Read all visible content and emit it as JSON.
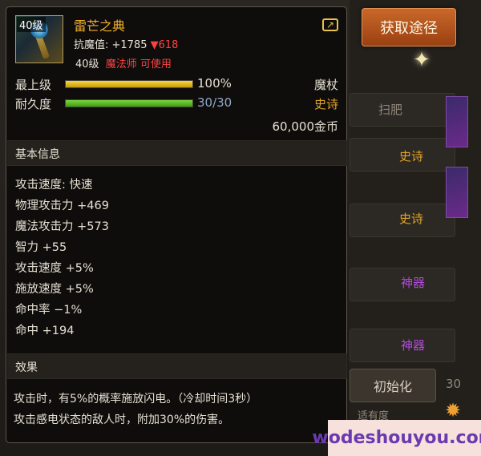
{
  "acquire_button": "获取途径",
  "item": {
    "level_badge": "40级",
    "name": "雷芒之典",
    "resist_label": "抗魔值: +1785",
    "resist_delta": "▼618",
    "req_level": "40级",
    "req_class": "魔法师 可使用"
  },
  "stats": {
    "grade_label": "最上级",
    "grade_value": "100%",
    "grade_fraction": 1.0,
    "durability_label": "耐久度",
    "durability_value": "30/30",
    "durability_fraction": 1.0,
    "type": "魔杖",
    "rarity": "史诗",
    "price": "60,000金币"
  },
  "sections": {
    "basic": "基本信息",
    "effect": "效果"
  },
  "attributes": [
    "攻击速度: 快速",
    "物理攻击力 +469",
    "魔法攻击力 +573",
    "智力 +55",
    "攻击速度 +5%",
    "施放速度 +5%",
    "命中率 −1%",
    "命中 +194"
  ],
  "effects": [
    "攻击时，有5%的概率施放闪电。（冷却时间3秒）",
    "攻击感电状态的敌人时，附加30%的伤害。"
  ],
  "background": {
    "tags": [
      "扫肥",
      "史诗",
      "史诗",
      "神器",
      "神器"
    ],
    "init_button": "初始化",
    "partial_text": "适有度",
    "partial_number": "30"
  },
  "watermark": "wodeshouyou.com",
  "colors": {
    "gold": "#f2b02a",
    "rarity_epic": "#e2a526",
    "rarity_artifact": "#b04ad6",
    "bar_grade": "#e6c21e",
    "bar_durability": "#55c02a",
    "warning_red": "#ff4242",
    "button_orange": "#c8682a"
  },
  "icons": {
    "share": "share-arrow-icon",
    "sparkle": "sparkle-icon",
    "corner": "sun-gear-icon"
  }
}
